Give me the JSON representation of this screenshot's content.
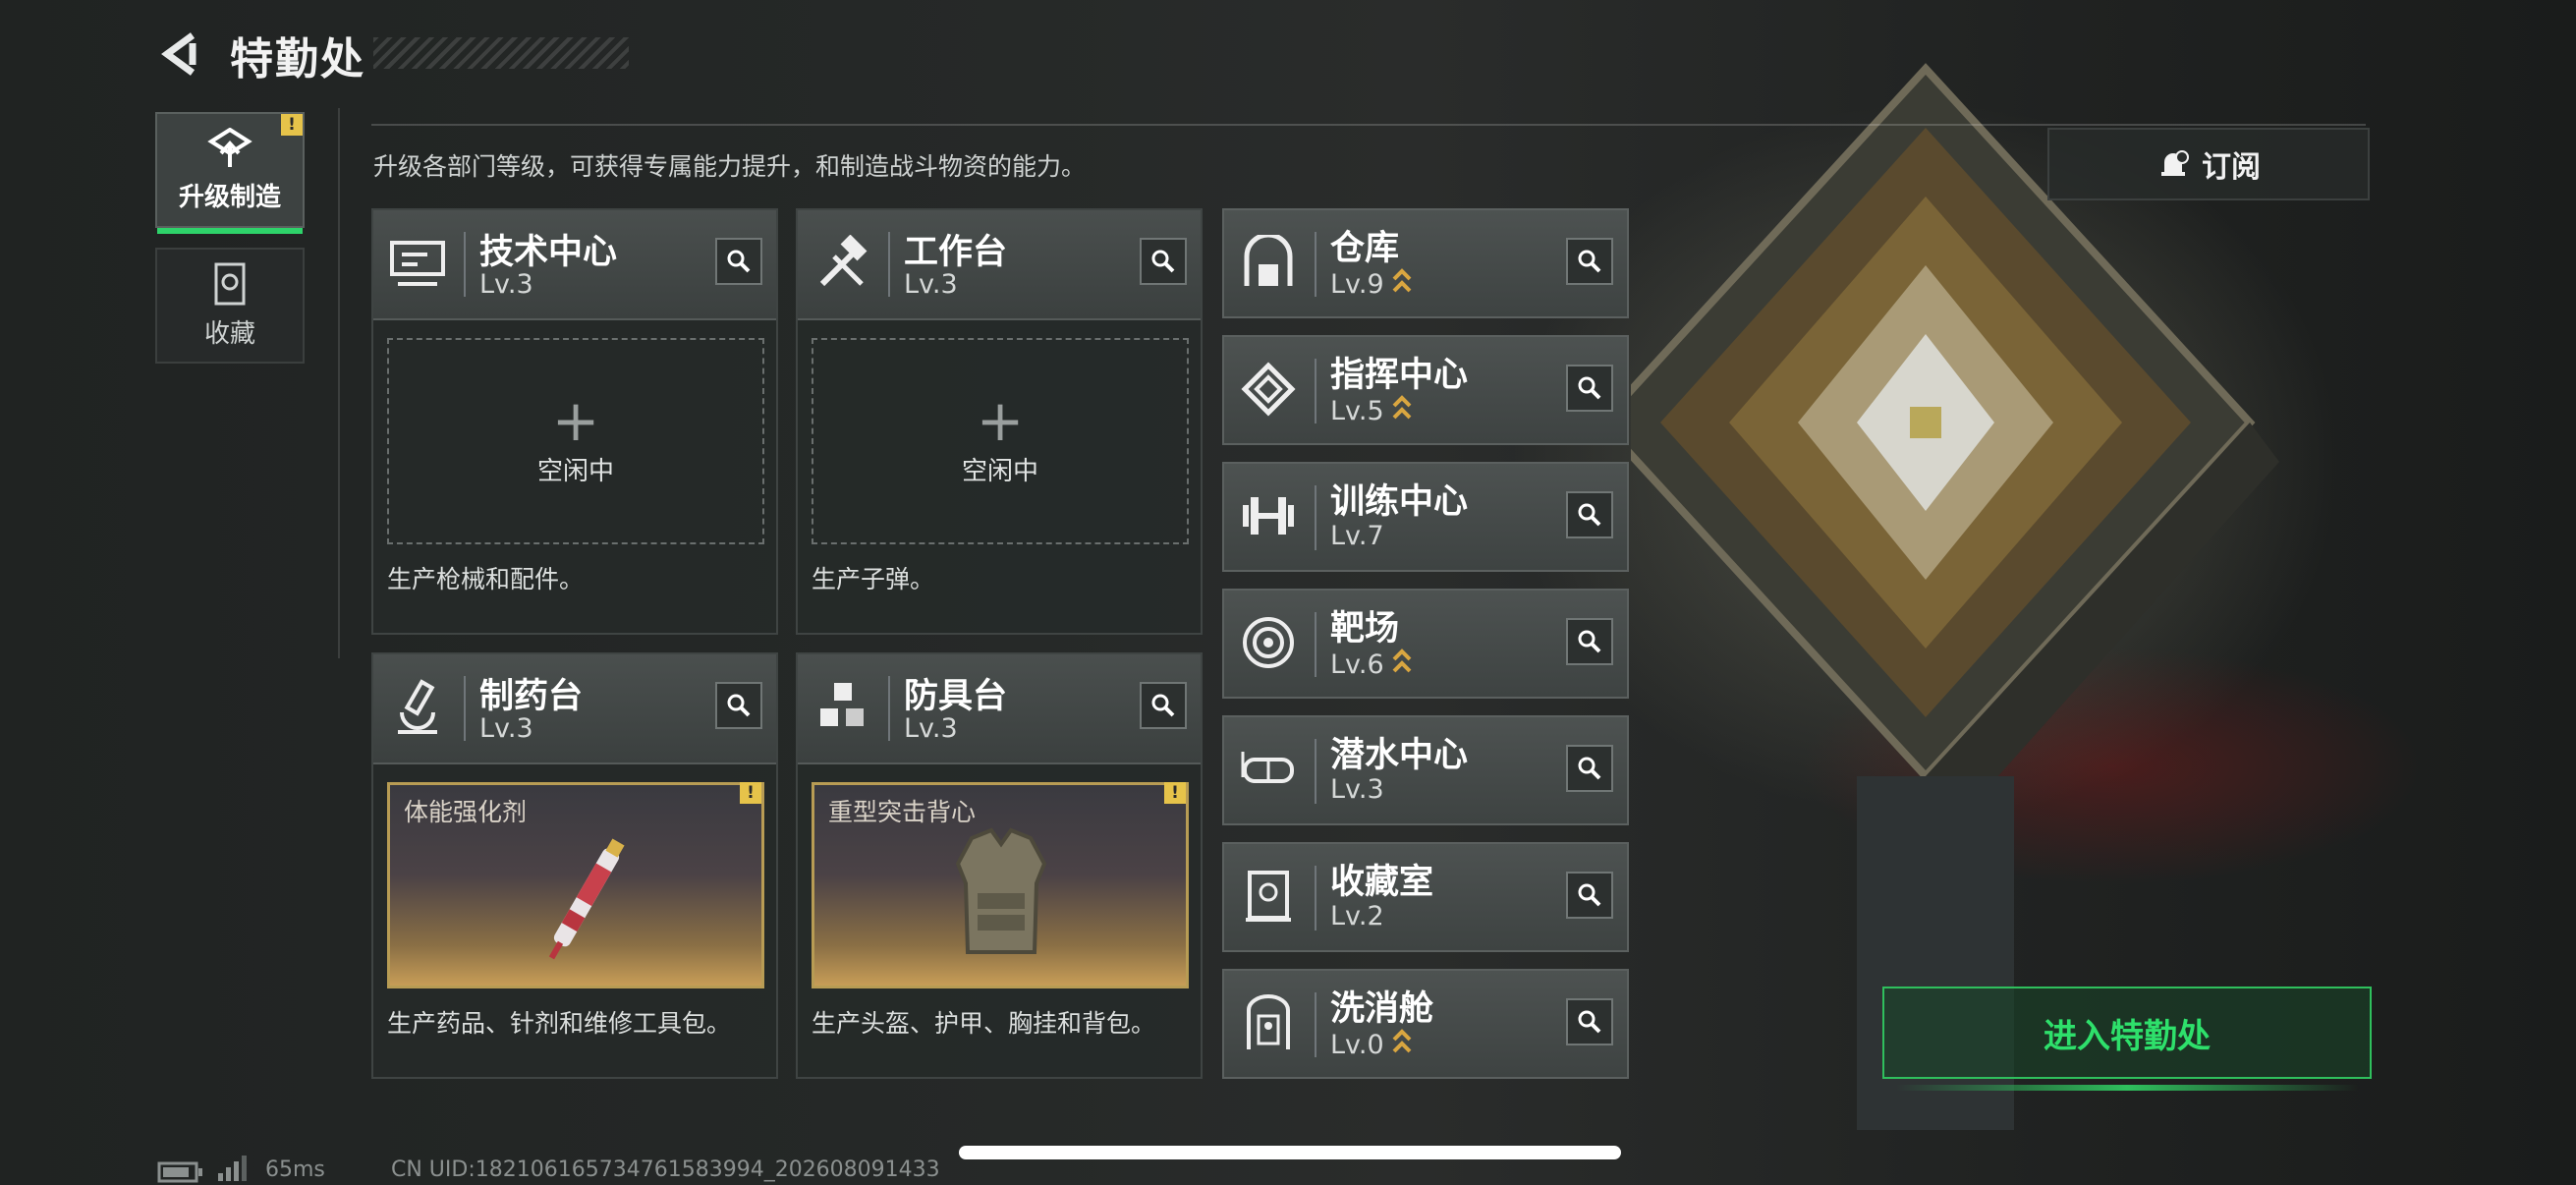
{
  "header": {
    "title": "特勤处"
  },
  "tabs": [
    {
      "label": "升级制造",
      "active": true,
      "icon": "upgrade-icon"
    },
    {
      "label": "收藏",
      "active": false,
      "icon": "collection-icon"
    }
  ],
  "description": "升级各部门等级，可获得专属能力提升，和制造战斗物资的能力。",
  "subscribe_label": "订阅",
  "workshops": [
    {
      "name": "技术中心",
      "level": "Lv.3",
      "icon": "tech-center-icon",
      "slot_label": "空闲中",
      "desc": "生产枪械和配件。"
    },
    {
      "name": "工作台",
      "level": "Lv.3",
      "icon": "workbench-icon",
      "slot_label": "空闲中",
      "desc": "生产子弹。"
    },
    {
      "name": "制药台",
      "level": "Lv.3",
      "icon": "pharmacy-icon",
      "product": "体能强化剂",
      "desc": "生产药品、针剂和维修工具包。"
    },
    {
      "name": "防具台",
      "level": "Lv.3",
      "icon": "armor-bench-icon",
      "product": "重型突击背心",
      "desc": "生产头盔、护甲、胸挂和背包。"
    }
  ],
  "facilities": [
    {
      "name": "仓库",
      "level": "Lv.9",
      "upgradable": true,
      "icon": "warehouse-icon"
    },
    {
      "name": "指挥中心",
      "level": "Lv.5",
      "upgradable": true,
      "icon": "command-center-icon"
    },
    {
      "name": "训练中心",
      "level": "Lv.7",
      "upgradable": false,
      "icon": "dumbbell-icon"
    },
    {
      "name": "靶场",
      "level": "Lv.6",
      "upgradable": true,
      "icon": "target-icon"
    },
    {
      "name": "潜水中心",
      "level": "Lv.3",
      "upgradable": false,
      "icon": "diving-mask-icon"
    },
    {
      "name": "收藏室",
      "level": "Lv.2",
      "upgradable": false,
      "icon": "collection-room-icon"
    },
    {
      "name": "洗消舱",
      "level": "Lv.0",
      "upgradable": true,
      "icon": "decon-chamber-icon"
    }
  ],
  "enter_label": "进入特勤处",
  "status": {
    "ping": "65ms",
    "uid": "CN UID:18210616573476158​3994_202608091433"
  },
  "colors": {
    "accent_green": "#2ee06b",
    "warning_yellow": "#e6c34a",
    "upgrade_gold": "#d9a640"
  }
}
